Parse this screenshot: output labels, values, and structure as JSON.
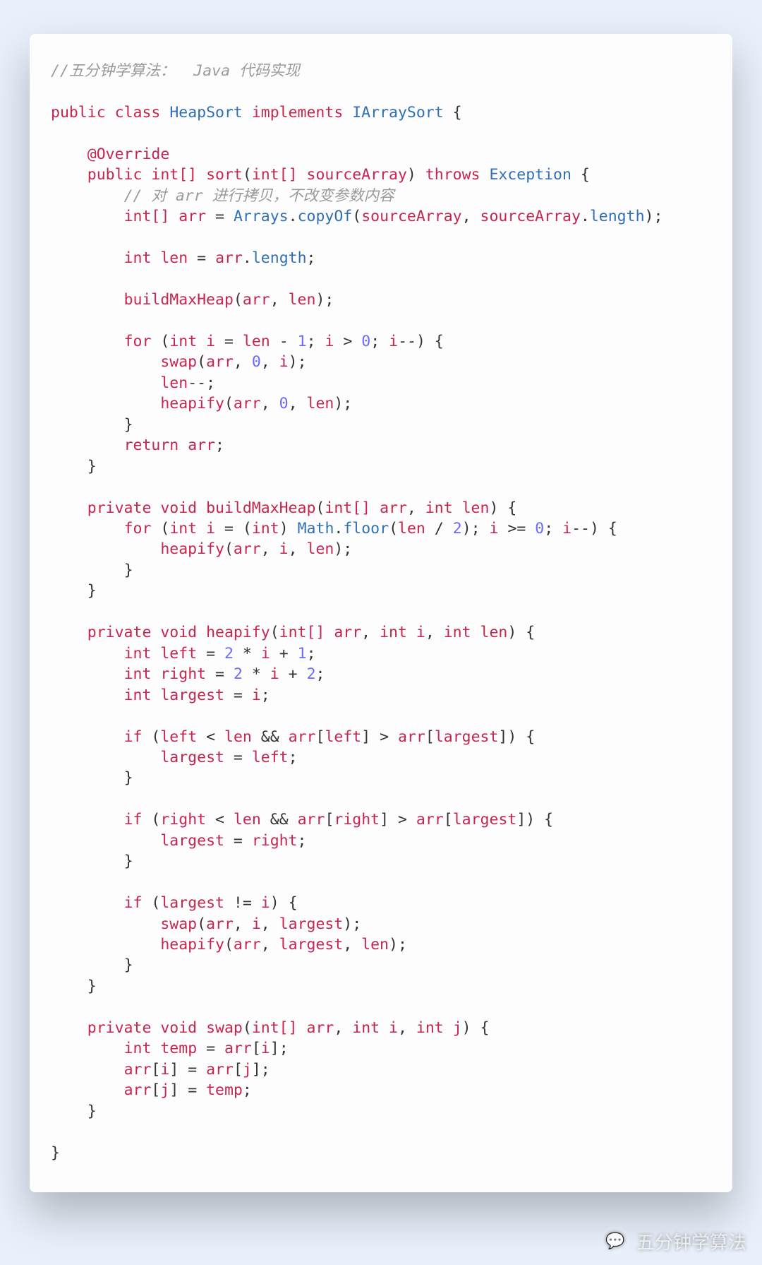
{
  "comments": {
    "top": "//五分钟学算法：  Java 代码实现",
    "copy": "// 对 arr 进行拷贝，不改变参数内容"
  },
  "kw": {
    "public": "public",
    "class": "class",
    "implements": "implements",
    "int": "int",
    "intarr": "int[]",
    "throws": "throws",
    "void": "void",
    "private": "private",
    "for": "for",
    "if": "if",
    "return": "return"
  },
  "cls": {
    "HeapSort": "HeapSort",
    "IArraySort": "IArraySort",
    "Exception": "Exception",
    "Arrays": "Arrays",
    "Math": "Math"
  },
  "ann": {
    "Override": "@Override"
  },
  "mtd": {
    "sort": "sort",
    "copyOf": "copyOf",
    "buildMaxHeap": "buildMaxHeap",
    "swap": "swap",
    "heapify": "heapify",
    "floor": "floor"
  },
  "id": {
    "sourceArray": "sourceArray",
    "arr": "arr",
    "len": "len",
    "length": "length",
    "i": "i",
    "j": "j",
    "left": "left",
    "right": "right",
    "largest": "largest",
    "temp": "temp"
  },
  "num": {
    "n0": "0",
    "n1": "1",
    "n2": "2"
  },
  "watermark": {
    "text": "五分钟学算法",
    "icon": "💬"
  }
}
